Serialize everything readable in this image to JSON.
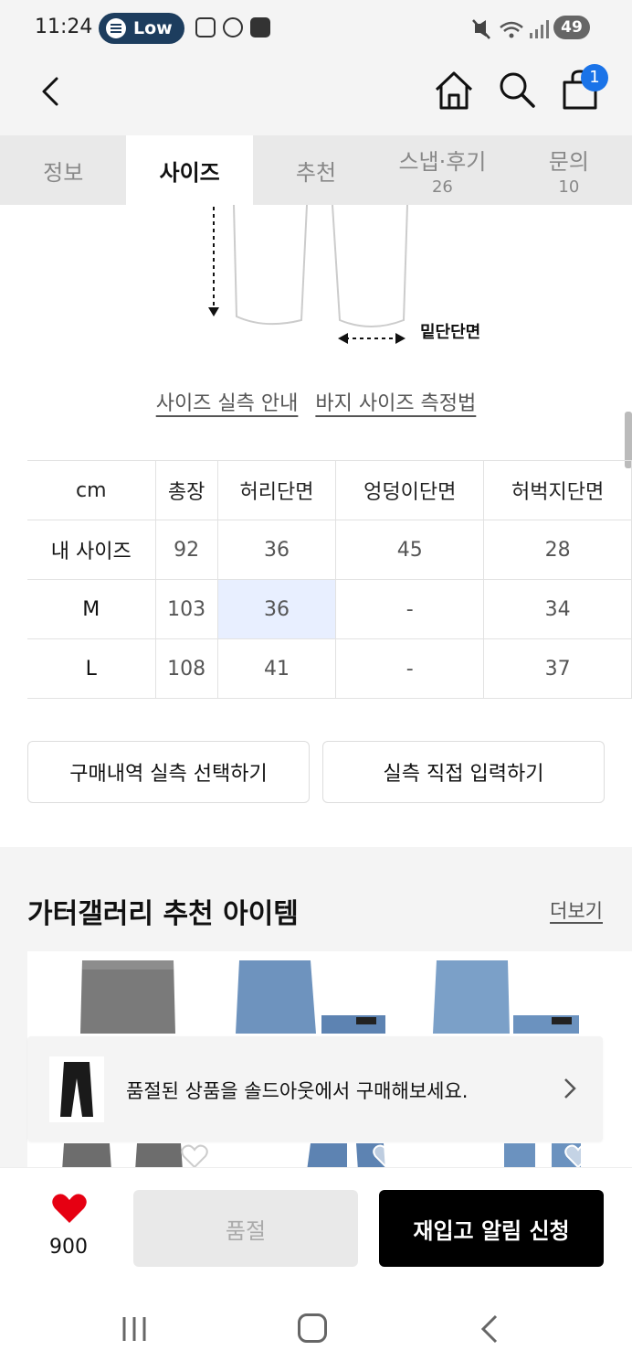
{
  "status_bar": {
    "time": "11:24",
    "pill_label": "Low",
    "battery": "49"
  },
  "header": {
    "cart_badge": "1"
  },
  "tabs": [
    {
      "label": "정보",
      "count": ""
    },
    {
      "label": "사이즈",
      "count": ""
    },
    {
      "label": "추천",
      "count": ""
    },
    {
      "label": "스냅·후기",
      "count": "26"
    },
    {
      "label": "문의",
      "count": "10"
    }
  ],
  "diagram": {
    "label": "밑단단면"
  },
  "guide_links": {
    "size_guide": "사이즈 실측 안내",
    "measure_guide": "바지 사이즈 측정법"
  },
  "size_table": {
    "headers": [
      "cm",
      "총장",
      "허리단면",
      "엉덩이단면",
      "허벅지단면"
    ],
    "rows": [
      [
        "내 사이즈",
        "92",
        "36",
        "45",
        "28"
      ],
      [
        "M",
        "103",
        "36",
        "-",
        "34"
      ],
      [
        "L",
        "108",
        "41",
        "-",
        "37"
      ]
    ]
  },
  "actions": {
    "select_history": "구매내역 실측 선택하기",
    "direct_input": "실측 직접 입력하기"
  },
  "recommend": {
    "title": "가터갤러리 추천 아이템",
    "more": "더보기"
  },
  "soldout_banner": {
    "text": "품절된 상품을 솔드아웃에서 구매해보세요."
  },
  "bottom_bar": {
    "like_count": "900",
    "soldout_label": "품절",
    "restock_label": "재입고 알림 신청"
  },
  "colors": {
    "accent": "#1a73e8",
    "like": "#e60012",
    "highlight": "#e8efff",
    "primary_button": "#000000"
  }
}
